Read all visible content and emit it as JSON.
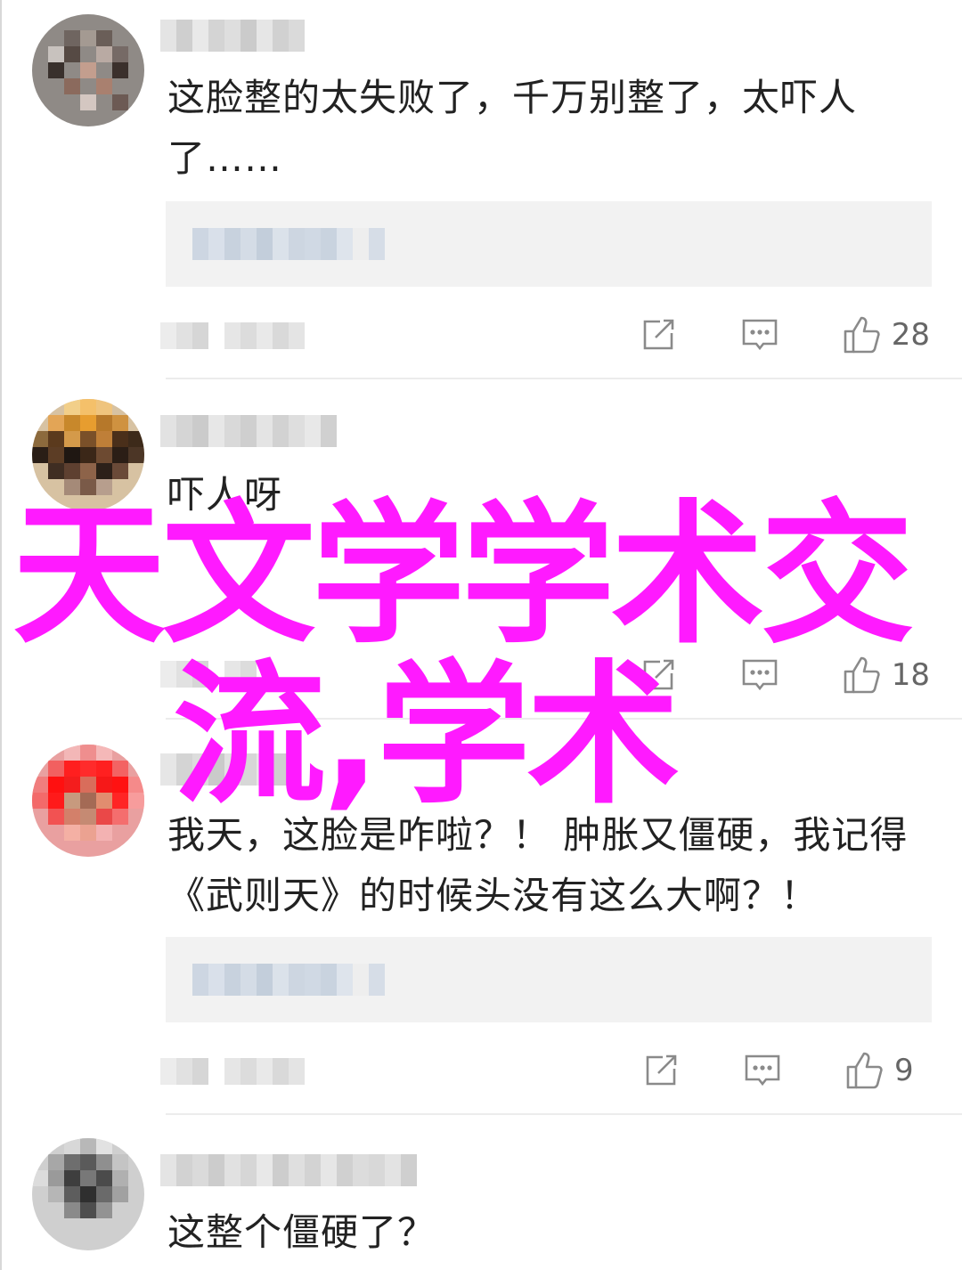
{
  "comments": [
    {
      "text": "这脸整的太失败了，千万别整了，太吓人了……",
      "likes": "28",
      "has_reply": true
    },
    {
      "text": "吓人呀",
      "likes": "18",
      "has_reply": false
    },
    {
      "text": "我天，这脸是咋啦？！ 肿胀又僵硬，我记得《武则天》的时候头没有这么大啊？！",
      "likes": "9",
      "has_reply": true
    },
    {
      "text": "这整个僵硬了？",
      "likes": "",
      "has_reply": false
    }
  ],
  "watermark": {
    "line1": "天文学学术交",
    "line2": "流,学术",
    "color": "#ff1aff"
  },
  "icons": {
    "share": "share-icon",
    "comment": "comment-icon",
    "like": "thumbs-up-icon"
  }
}
